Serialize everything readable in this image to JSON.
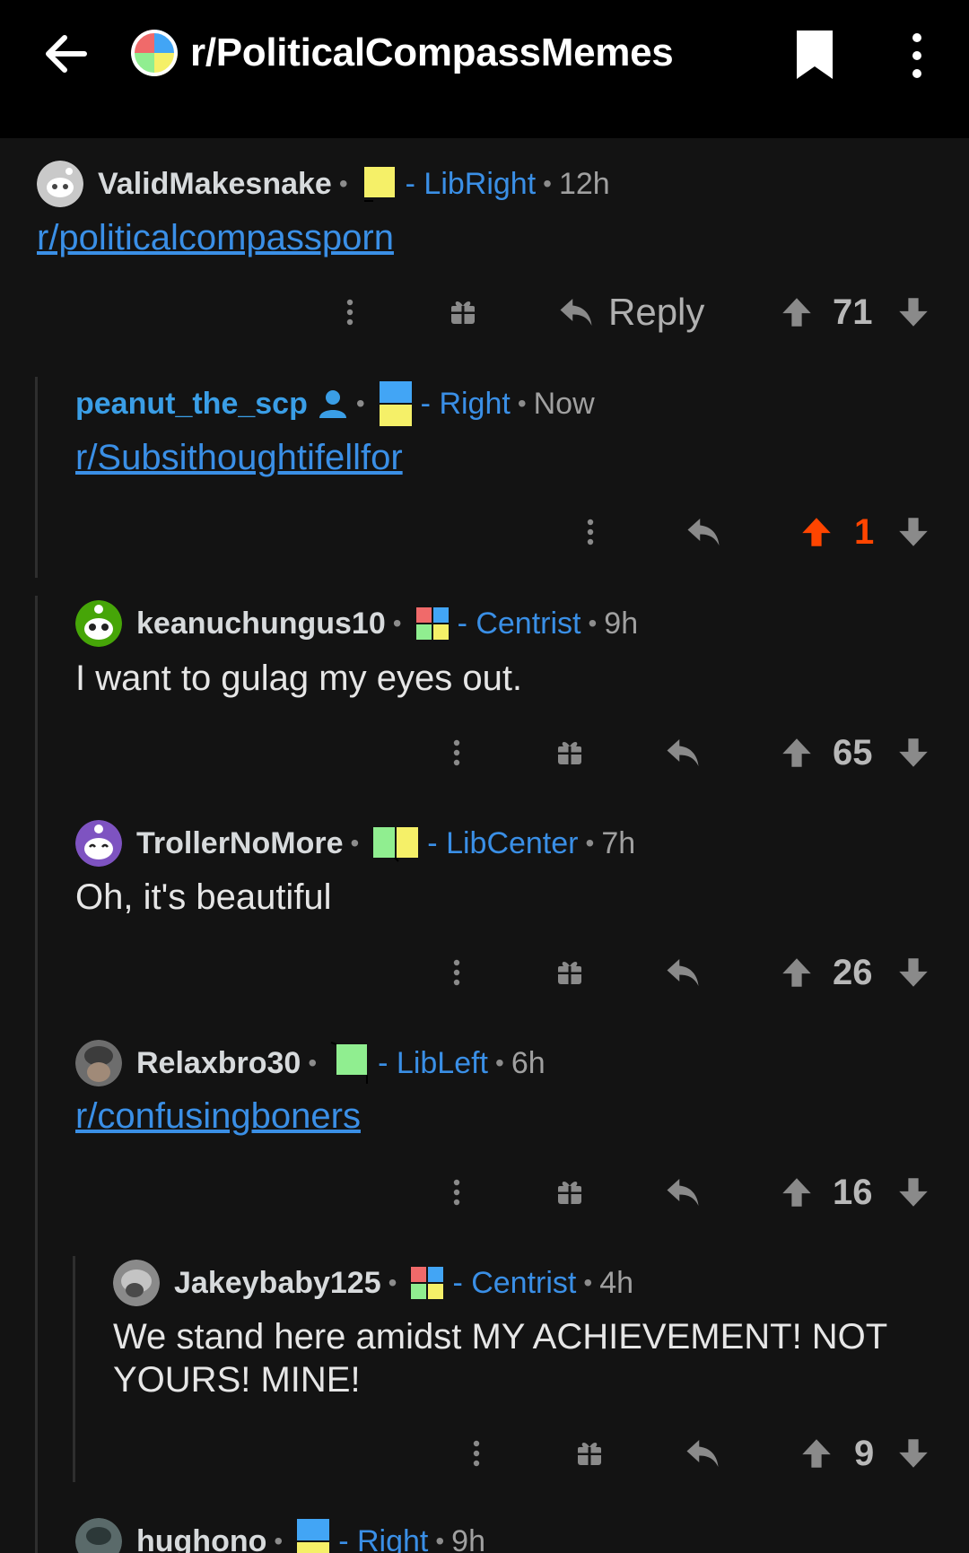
{
  "header": {
    "title": "r/PoliticalCompassMemes",
    "back_icon": "arrow-left-icon",
    "bookmark_icon": "bookmark-icon",
    "more_icon": "more-vertical-icon"
  },
  "colors": {
    "link_blue": "#3a8fe6",
    "upvote_orange": "#ff4500",
    "flair_yellow": "#f5f068",
    "flair_blue": "#42a5f5",
    "flair_green": "#90ee90",
    "flair_red": "#f06a6a"
  },
  "comments": [
    {
      "username": "ValidMakesnake",
      "flair": "- LibRight",
      "time": "12h",
      "link": "r/politicalcompassporn",
      "reply_label": "Reply",
      "score": "71"
    },
    {
      "username": "peanut_the_scp",
      "flair": "- Right",
      "time": "Now",
      "link": "r/Subsithoughtifellfor",
      "score": "1"
    },
    {
      "username": "keanuchungus10",
      "flair": "- Centrist",
      "time": "9h",
      "text": "I want to gulag my eyes out.",
      "score": "65"
    },
    {
      "username": "TrollerNoMore",
      "flair": "- LibCenter",
      "time": "7h",
      "text": "Oh, it's beautiful",
      "score": "26"
    },
    {
      "username": "Relaxbro30",
      "flair": "- LibLeft",
      "time": "6h",
      "link": "r/confusingboners",
      "score": "16"
    },
    {
      "username": "Jakeybaby125",
      "flair": "- Centrist",
      "time": "4h",
      "text": "We stand here amidst MY ACHIEVEMENT! NOT YOURS! MINE!",
      "score": "9"
    },
    {
      "username": "hughono",
      "flair": "- Right",
      "time": "9h"
    }
  ],
  "dot_separator": "•"
}
